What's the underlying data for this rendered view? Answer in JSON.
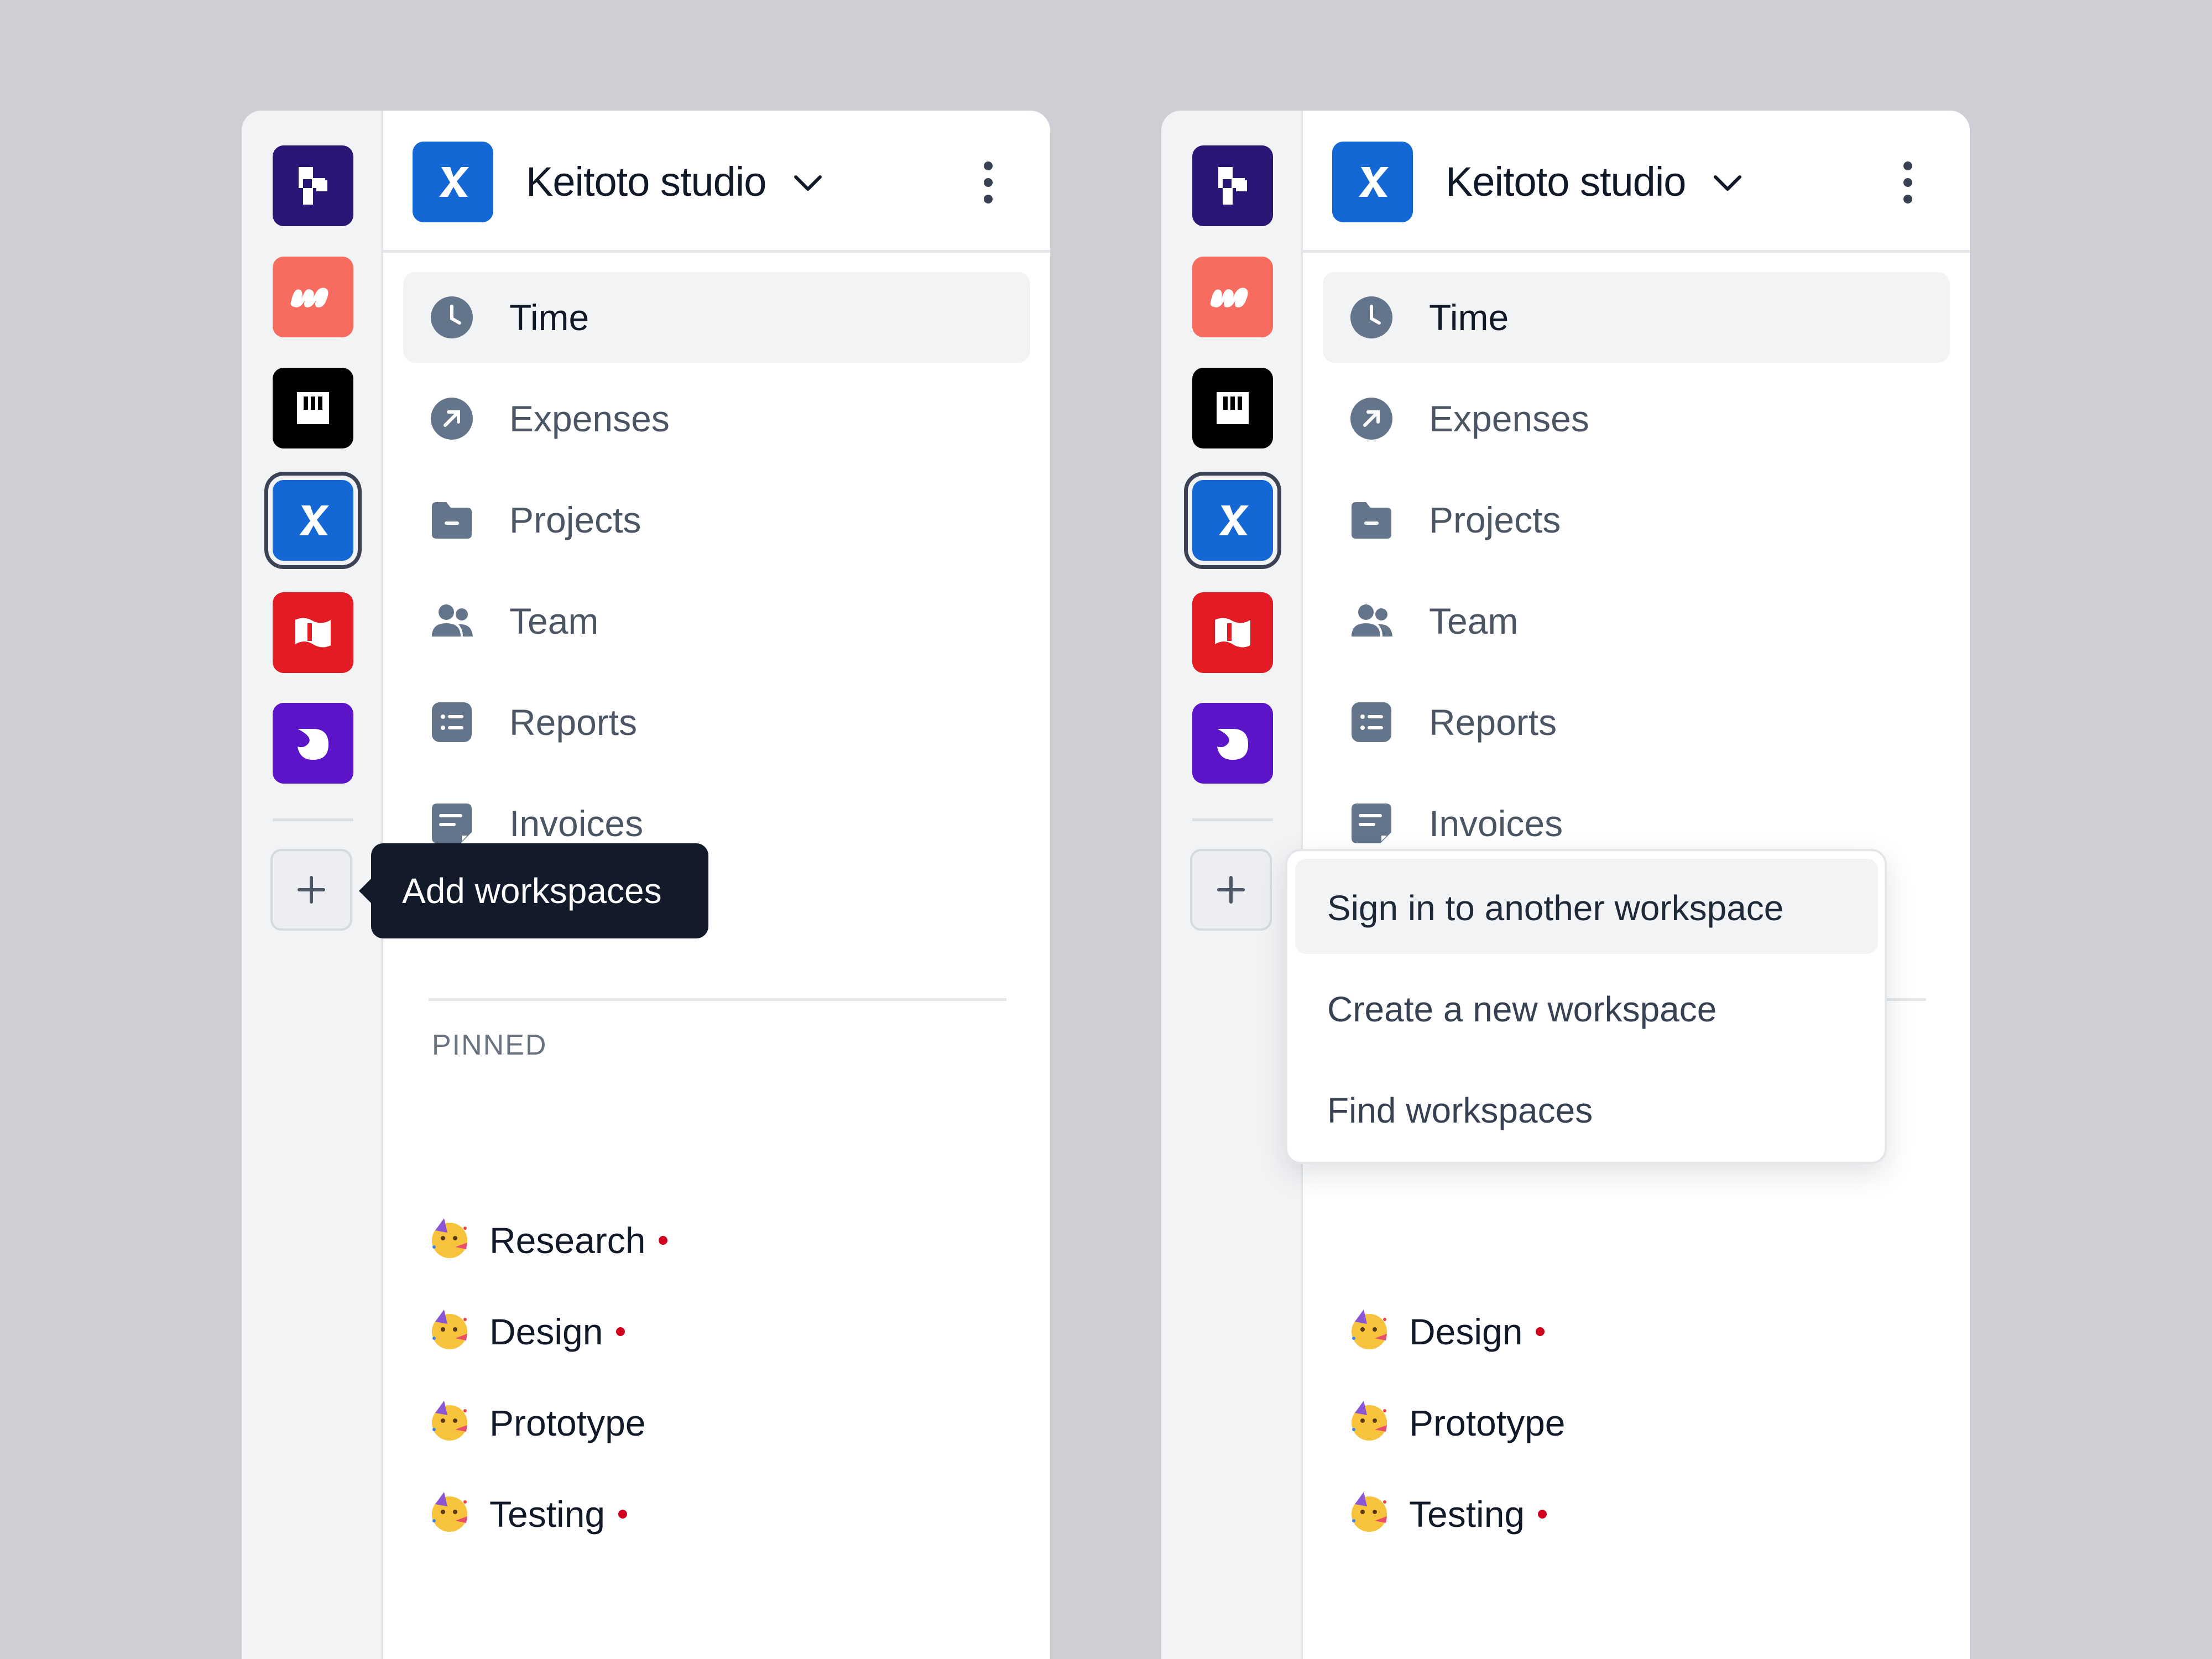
{
  "header": {
    "workspace_name": "Keitoto studio"
  },
  "nav": [
    {
      "label": "Time",
      "icon": "clock-icon",
      "selected": true
    },
    {
      "label": "Expenses",
      "icon": "arrow-up-right-circle-icon"
    },
    {
      "label": "Projects",
      "icon": "folder-icon"
    },
    {
      "label": "Team",
      "icon": "users-icon"
    },
    {
      "label": "Reports",
      "icon": "list-icon"
    },
    {
      "label": "Invoices",
      "icon": "invoice-icon"
    }
  ],
  "pinned": {
    "heading": "PINNED",
    "items": [
      {
        "label": "Research",
        "unread": true
      },
      {
        "label": "Design",
        "unread": true
      },
      {
        "label": "Prototype",
        "unread": false
      },
      {
        "label": "Testing",
        "unread": true
      }
    ]
  },
  "tooltip": {
    "text": "Add workspaces"
  },
  "dropdown": {
    "items": [
      {
        "label": "Sign in to another workspace"
      },
      {
        "label": "Create a new workspace"
      },
      {
        "label": "Find workspaces"
      }
    ]
  },
  "colors": {
    "accent": "#1368d6",
    "tooltip_bg": "#131a2a",
    "unread_dot": "#d1001f",
    "icon_gray": "#64748b"
  },
  "workspaces": [
    {
      "icon": "purple-arrow-logo-icon",
      "color": "#2a1775"
    },
    {
      "icon": "coral-w-logo-icon",
      "color": "#f76c5e"
    },
    {
      "icon": "black-w-logo-icon",
      "color": "#000000"
    },
    {
      "icon": "keitoto-x-logo-icon",
      "color": "#1368d6"
    },
    {
      "icon": "red-flag-logo-icon",
      "color": "#e31b23"
    },
    {
      "icon": "violet-d-logo-icon",
      "color": "#5b14c8"
    }
  ]
}
